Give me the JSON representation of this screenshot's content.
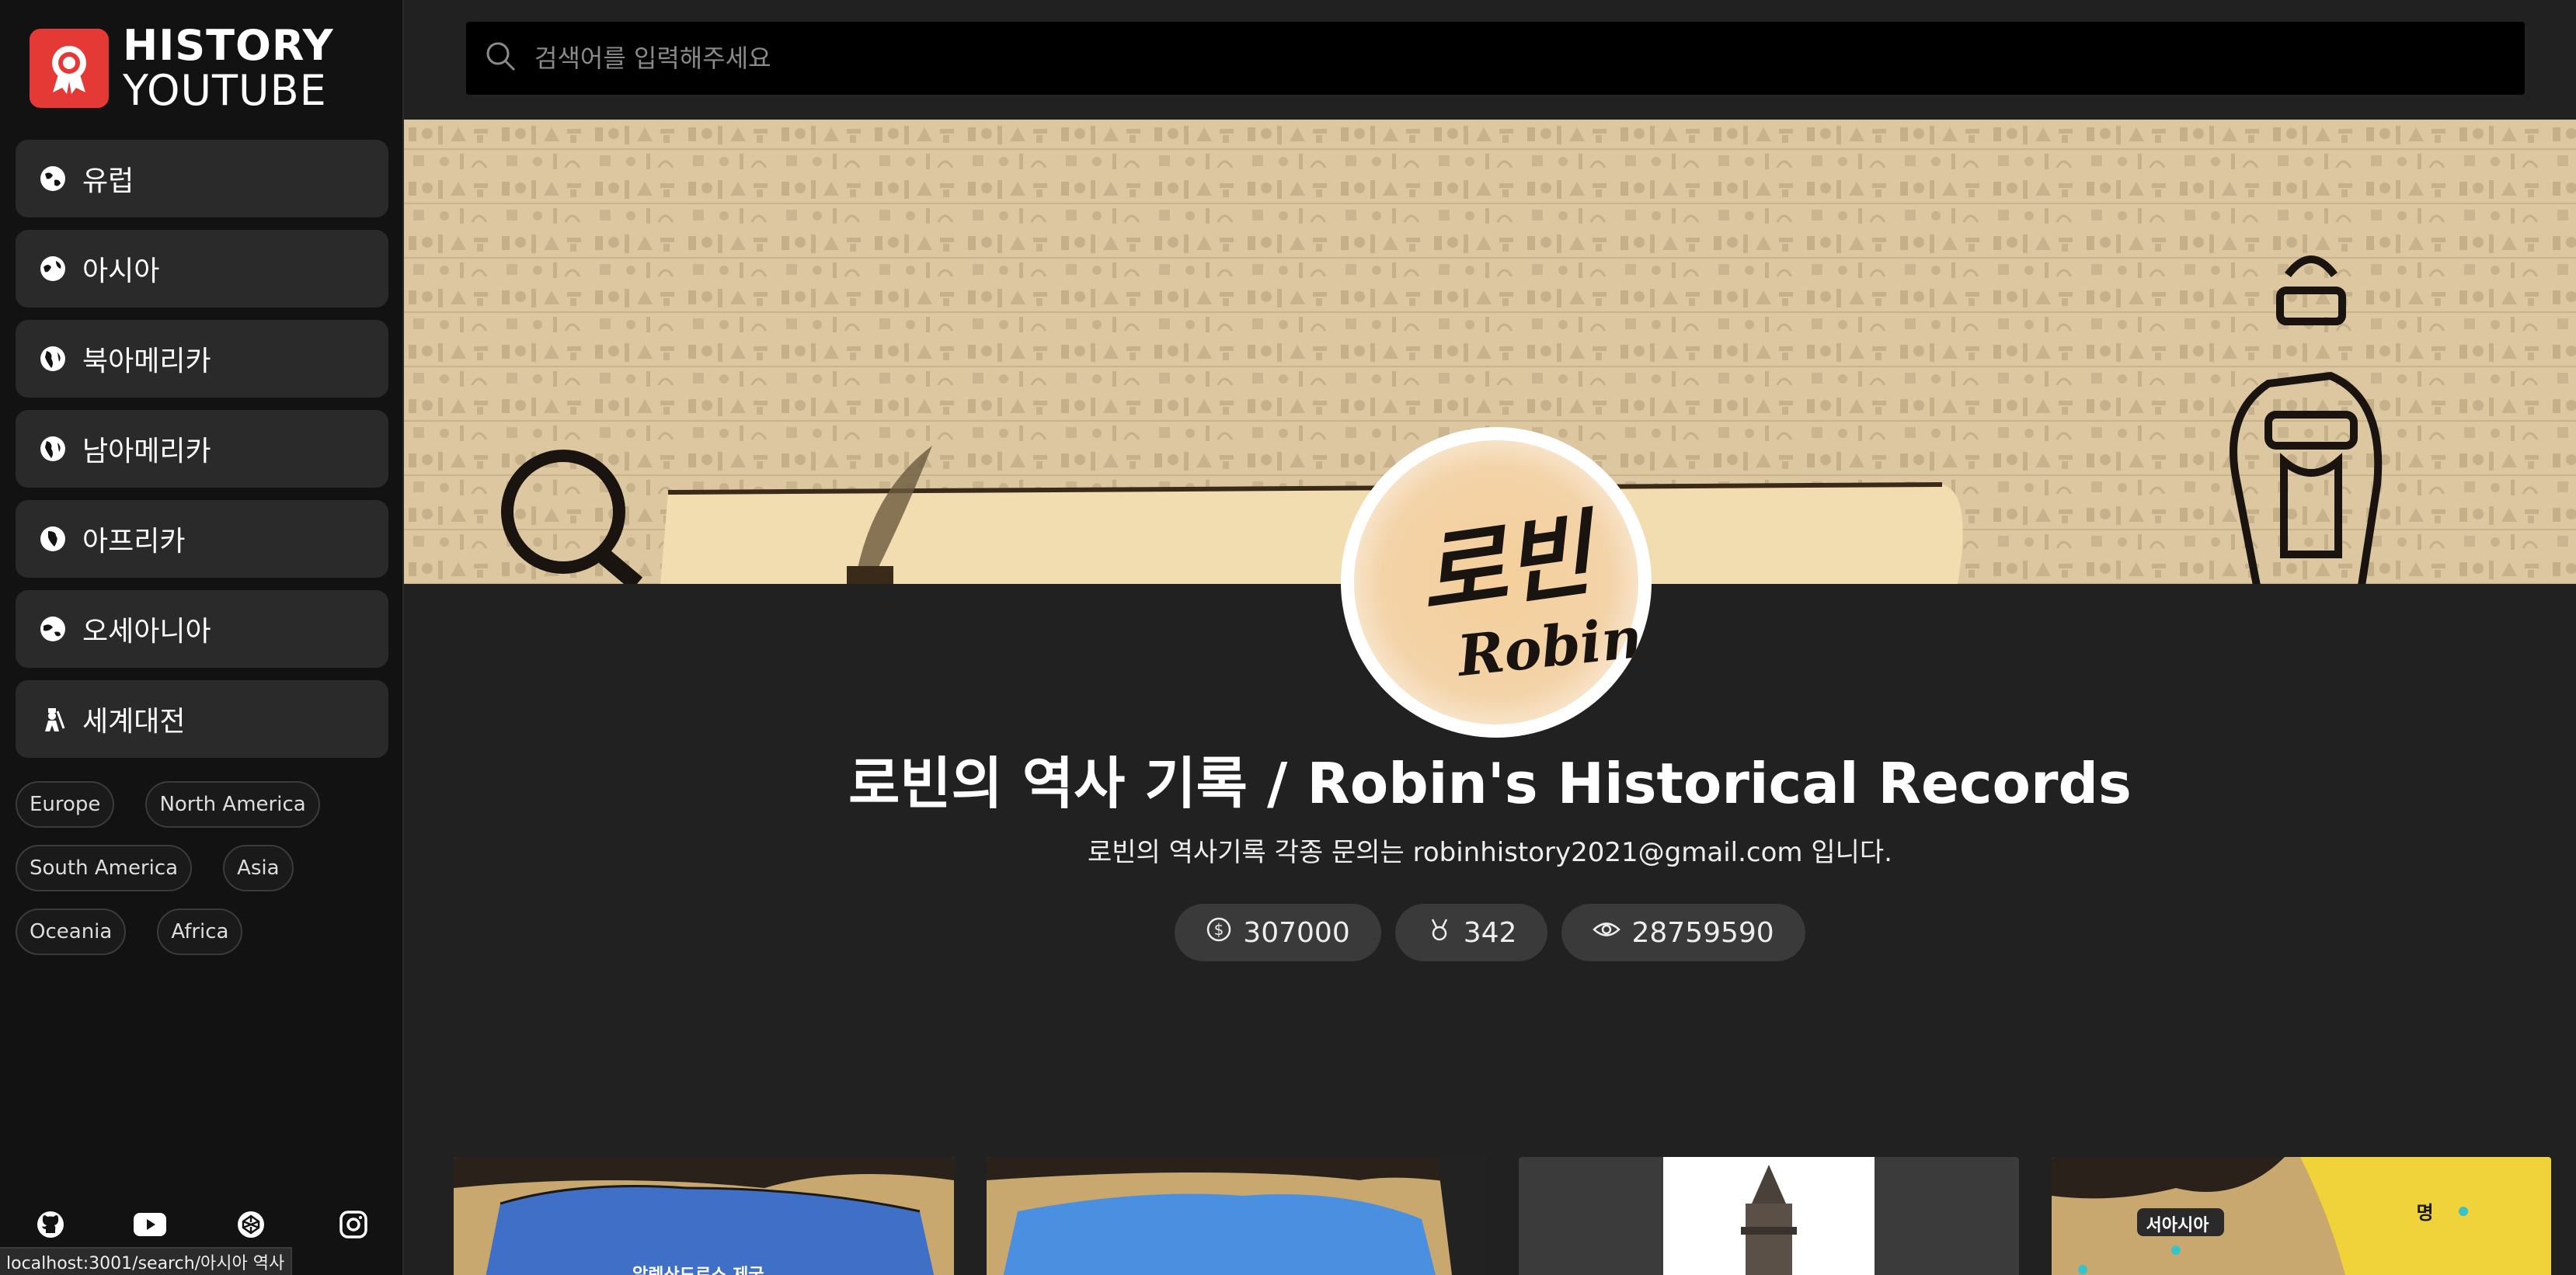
{
  "logo": {
    "line1": "HISTORY",
    "line2": "YOUTUBE"
  },
  "sidebar": {
    "items": [
      {
        "label": "유럽",
        "icon": "globe-europe-icon"
      },
      {
        "label": "아시아",
        "icon": "globe-asia-icon"
      },
      {
        "label": "북아메리카",
        "icon": "globe-americas-icon"
      },
      {
        "label": "남아메리카",
        "icon": "globe-americas-icon"
      },
      {
        "label": "아프리카",
        "icon": "globe-africa-icon"
      },
      {
        "label": "오세아니아",
        "icon": "globe-oceania-icon"
      },
      {
        "label": "세계대전",
        "icon": "soldier-icon"
      }
    ],
    "tags": [
      "Europe",
      "North America",
      "South America",
      "Asia",
      "Oceania",
      "Africa"
    ],
    "social": [
      "github-icon",
      "youtube-icon",
      "codepen-icon",
      "instagram-icon"
    ]
  },
  "search": {
    "placeholder": "검색어를 입력해주세요"
  },
  "channel": {
    "avatar_text_ko": "로빈",
    "avatar_text_en": "Robin",
    "title": "로빈의 역사 기록 / Robin's Historical Records",
    "description": "로빈의 역사기록 각종 문의는 robinhistory2021@gmail.com 입니다.",
    "stats": {
      "subscribers": "307000",
      "videos": "342",
      "views": "28759590"
    }
  },
  "thumbnails": [
    {
      "label": "알렉산드로스 제국"
    },
    {
      "label": ""
    },
    {
      "label": ""
    },
    {
      "label": "서아시아",
      "label2": "명"
    }
  ],
  "status_url": "localhost:3001/search/아시아 역사",
  "colors": {
    "accent": "#e53935",
    "sidebar_bg": "#121212",
    "main_bg": "#212121"
  }
}
